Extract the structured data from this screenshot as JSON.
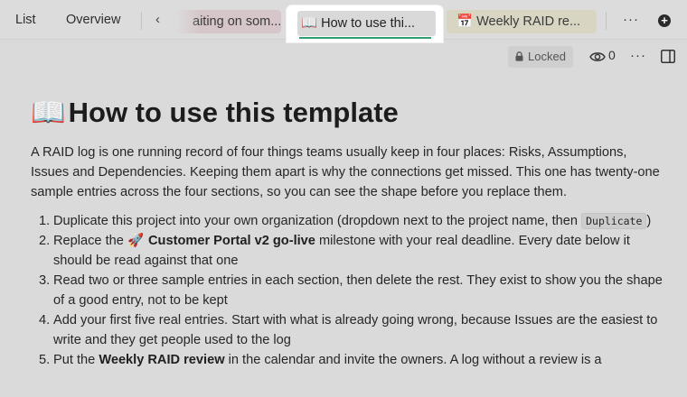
{
  "tabs": {
    "list": "List",
    "overview": "Overview",
    "pink_tab": "aiting on som...",
    "active_emoji": "📖",
    "active_label": "How to use thi...",
    "yellow_emoji": "📅",
    "yellow_label": "Weekly RAID re...",
    "more": "···",
    "add": "+"
  },
  "toolbar": {
    "locked_label": "Locked",
    "views_count": "0",
    "more": "···"
  },
  "doc": {
    "title_emoji": "📖",
    "title": "How to use this template",
    "intro": "A RAID log is one running record of four things teams usually keep in four places: Risks, Assumptions, Issues and Dependencies. Keeping them apart is why the connections get missed. This one has twenty-one sample entries across the four sections, so you can see the shape before you replace them.",
    "steps": [
      {
        "num": "1.",
        "before": "Duplicate this project into your own organization (dropdown next to the project name, then ",
        "code": "Duplicate",
        "after": ")"
      },
      {
        "num": "2.",
        "before": "Replace the ",
        "emoji": "🚀",
        "bold": "Customer Portal v2 go-live",
        "after": " milestone with your real deadline. Every date below it should be read against that one"
      },
      {
        "num": "3.",
        "text": "Read two or three sample entries in each section, then delete the rest. They exist to show you the shape of a good entry, not to be kept"
      },
      {
        "num": "4.",
        "text": "Add your first five real entries. Start with what is already going wrong, because Issues are the easiest to write and they get people used to the log"
      },
      {
        "num": "5.",
        "before": "Put the ",
        "bold": "Weekly RAID review",
        "after": " in the calendar and invite the owners. A log without a review is a"
      }
    ]
  },
  "colors": {
    "accent": "#2e9e73",
    "background": "#dadada",
    "pink_tab": "#d6c6c9",
    "yellow_tab": "#d9d5c3"
  },
  "icons": {
    "lock": "lock-icon",
    "eye": "eye-icon",
    "more": "more-horizontal-icon",
    "sidebar": "sidebar-toggle-icon",
    "chevron": "chevron-left-icon",
    "add": "add-circle-icon"
  }
}
